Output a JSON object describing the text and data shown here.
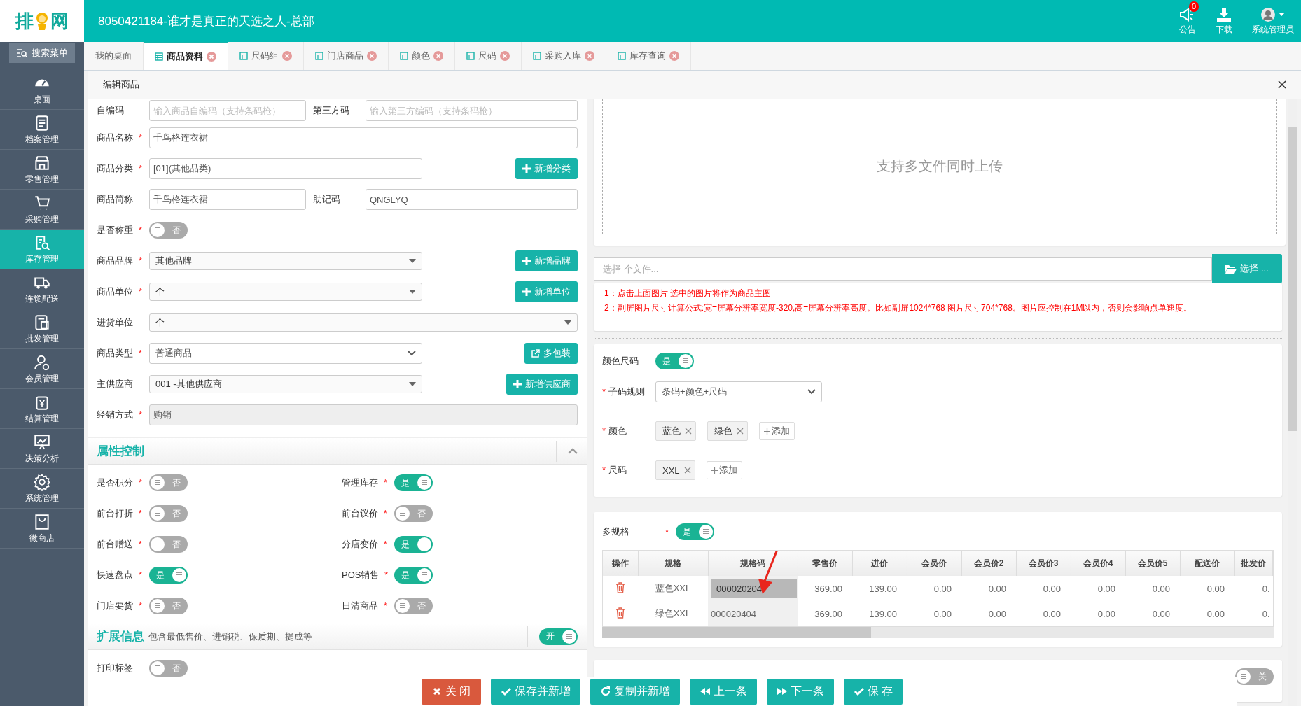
{
  "header": {
    "logo_left": "排",
    "logo_right": "网",
    "title": "8050421184-谁才是真正的天选之人-总部",
    "actions": [
      {
        "kind": "notice",
        "label": "公告",
        "badge": "0"
      },
      {
        "kind": "download",
        "label": "下载"
      },
      {
        "kind": "user",
        "label": "系统管理员"
      }
    ]
  },
  "sidebar": {
    "search": "搜索菜单",
    "items": [
      {
        "kind": "dashboard",
        "label": "桌面",
        "selected": false
      },
      {
        "kind": "archive",
        "label": "档案管理",
        "selected": false
      },
      {
        "kind": "retail",
        "label": "零售管理",
        "selected": false
      },
      {
        "kind": "purchase",
        "label": "采购管理",
        "selected": false
      },
      {
        "kind": "stock",
        "label": "库存管理",
        "selected": true
      },
      {
        "kind": "chain",
        "label": "连锁配送",
        "selected": false
      },
      {
        "kind": "wholesale",
        "label": "批发管理",
        "selected": false
      },
      {
        "kind": "member",
        "label": "会员管理",
        "selected": false
      },
      {
        "kind": "settle",
        "label": "结算管理",
        "selected": false
      },
      {
        "kind": "analysis",
        "label": "决策分析",
        "selected": false
      },
      {
        "kind": "system",
        "label": "系统管理",
        "selected": false
      },
      {
        "kind": "shop",
        "label": "微商店",
        "selected": false
      }
    ]
  },
  "tabs": [
    {
      "label": "我的桌面",
      "selected": false,
      "closable": false
    },
    {
      "label": "商品资料",
      "selected": true,
      "closable": true
    },
    {
      "label": "尺码组",
      "selected": false,
      "closable": true
    },
    {
      "label": "门店商品",
      "selected": false,
      "closable": true
    },
    {
      "label": "颜色",
      "selected": false,
      "closable": true
    },
    {
      "label": "尺码",
      "selected": false,
      "closable": true
    },
    {
      "label": "采购入库",
      "selected": false,
      "closable": true
    },
    {
      "label": "库存查询",
      "selected": false,
      "closable": true
    }
  ],
  "panel": {
    "title": "编辑商品"
  },
  "required_mark": "*",
  "form": {
    "rows": [
      {
        "fields": [
          {
            "kind": "input",
            "label": "自编码",
            "required": false,
            "placeholder": "输入商品自编码（支持条码枪）"
          },
          {
            "kind": "input",
            "label": "第三方码",
            "required": false,
            "placeholder": "输入第三方编码（支持条码枪）"
          }
        ]
      },
      {
        "fields": [
          {
            "kind": "input",
            "label": "商品名称",
            "required": true,
            "value": "千鸟格连衣裙"
          }
        ]
      },
      {
        "fields": [
          {
            "kind": "input",
            "label": "商品分类",
            "required": true,
            "value": "[01](其他品类)"
          }
        ],
        "button": {
          "kind": "plus",
          "label": "新增分类"
        }
      },
      {
        "fields": [
          {
            "kind": "input",
            "label": "商品简称",
            "required": false,
            "value": "千鸟格连衣裙"
          },
          {
            "kind": "input",
            "label": "助记码",
            "required": false,
            "value": "QNGLYQ"
          }
        ]
      },
      {
        "fields": [
          {
            "kind": "toggle",
            "label": "是否称重",
            "required": true,
            "on": false,
            "text": "否"
          }
        ]
      },
      {
        "fields": [
          {
            "kind": "select",
            "label": "商品品牌",
            "required": true,
            "value": "其他品牌"
          }
        ],
        "button": {
          "kind": "plus",
          "label": "新增品牌"
        }
      },
      {
        "fields": [
          {
            "kind": "select",
            "label": "商品单位",
            "required": true,
            "value": "个"
          }
        ],
        "button": {
          "kind": "plus",
          "label": "新增单位"
        }
      },
      {
        "fields": [
          {
            "kind": "select",
            "label": "进货单位",
            "required": false,
            "value": "个"
          }
        ]
      },
      {
        "fields": [
          {
            "kind": "native-select",
            "label": "商品类型",
            "required": true,
            "value": "普通商品"
          }
        ],
        "button": {
          "kind": "link",
          "label": "多包装"
        }
      },
      {
        "fields": [
          {
            "kind": "select",
            "label": "主供应商",
            "required": false,
            "value": "001 -其他供应商"
          }
        ],
        "button": {
          "kind": "plus",
          "label": "新增供应商"
        }
      },
      {
        "fields": [
          {
            "kind": "readonly",
            "label": "经销方式",
            "required": true,
            "value": "购销"
          }
        ]
      }
    ]
  },
  "attributes": {
    "title": "属性控制",
    "toggles": [
      {
        "label": "是否积分",
        "required": true,
        "on": false,
        "text": "否"
      },
      {
        "label": "管理库存",
        "required": true,
        "on": true,
        "text": "是"
      },
      {
        "label": "前台打折",
        "required": true,
        "on": false,
        "text": "否"
      },
      {
        "label": "前台议价",
        "required": true,
        "on": false,
        "text": "否"
      },
      {
        "label": "前台赠送",
        "required": true,
        "on": false,
        "text": "否"
      },
      {
        "label": "分店变价",
        "required": true,
        "on": true,
        "text": "是"
      },
      {
        "label": "快速盘点",
        "required": true,
        "on": true,
        "text": "是"
      },
      {
        "label": "POS销售",
        "required": true,
        "on": true,
        "text": "是"
      },
      {
        "label": "门店要货",
        "required": true,
        "on": false,
        "text": "否"
      },
      {
        "label": "日清商品",
        "required": true,
        "on": false,
        "text": "否"
      }
    ]
  },
  "extension": {
    "title": "扩展信息",
    "note": "包含最低售价、进销税、保质期、提成等",
    "toggle": {
      "on": true,
      "text": "开"
    },
    "toggles": [
      {
        "label": "打印标签",
        "required": false,
        "on": false,
        "text": "否"
      }
    ]
  },
  "upload": {
    "hint": "支持多文件同时上传",
    "file_placeholder": "选择 个文件...",
    "button": "选择 ...",
    "notes": [
      "1：点击上面图片 选中的图片将作为商品主图",
      "2：副屏图片尺寸计算公式:宽=屏幕分辨率宽度-320,高=屏幕分辨率高度。比如副屏1024*768 图片尺寸704*768。图片应控制在1M以内，否则会影响点单速度。"
    ]
  },
  "color_size": {
    "label": "颜色尺码",
    "toggle": {
      "on": true,
      "text": "是"
    },
    "rule_label": "子码规则",
    "rule_value": "条码+颜色+尺码",
    "rule_required": true,
    "groups": [
      {
        "label": "颜色",
        "required": true,
        "tags": [
          "蓝色",
          "绿色"
        ],
        "add": "添加"
      },
      {
        "label": "尺码",
        "required": true,
        "tags": [
          "XXL"
        ],
        "add": "添加"
      }
    ]
  },
  "multi_spec": {
    "label": "多规格",
    "required": true,
    "toggle": {
      "on": true,
      "text": "是"
    },
    "columns": [
      "操作",
      "规格",
      "规格码",
      "零售价",
      "进价",
      "会员价",
      "会员价2",
      "会员价3",
      "会员价4",
      "会员价5",
      "配送价",
      "批发价"
    ],
    "rows": [
      {
        "spec": "蓝色XXL",
        "code": "000020204",
        "code_selected": true,
        "prices": [
          "369.00",
          "139.00",
          "0.00",
          "0.00",
          "0.00",
          "0.00",
          "0.00",
          "0.00",
          "0."
        ]
      },
      {
        "spec": "绿色XXL",
        "code": "000020404",
        "code_selected": false,
        "prices": [
          "369.00",
          "139.00",
          "0.00",
          "0.00",
          "0.00",
          "0.00",
          "0.00",
          "0.00",
          "0."
        ]
      }
    ]
  },
  "copy_section": {
    "toggle": {
      "on": false,
      "text": "关"
    }
  },
  "footer_buttons": [
    {
      "kind": "close",
      "label": "关 闭"
    },
    {
      "kind": "check",
      "label": "保存并新增"
    },
    {
      "kind": "refresh",
      "label": "复制并新增"
    },
    {
      "kind": "prev",
      "label": "上一条"
    },
    {
      "kind": "next",
      "label": "下一条"
    },
    {
      "kind": "check",
      "label": "保 存"
    }
  ]
}
